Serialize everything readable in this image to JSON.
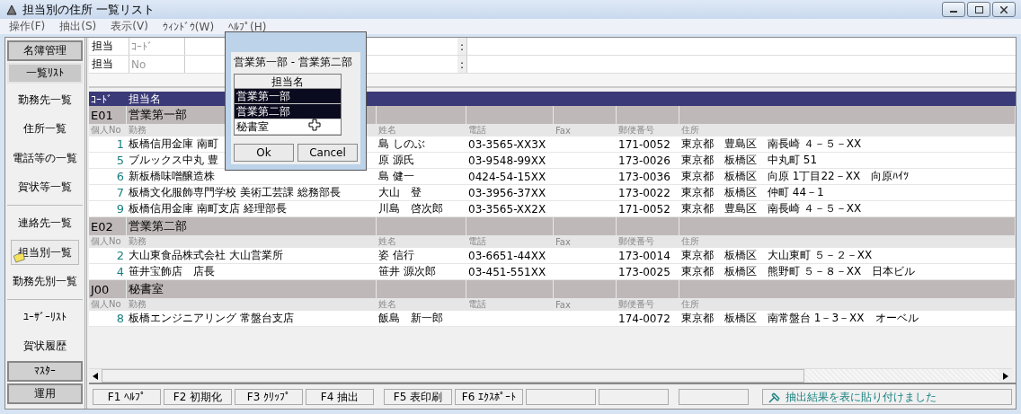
{
  "window": {
    "title": "担当別の住所 一覧リスト"
  },
  "menu": [
    {
      "label": "操作(F)"
    },
    {
      "label": "抽出(S)"
    },
    {
      "label": "表示(V)"
    },
    {
      "label": "ｳｨﾝﾄﾞｳ(W)"
    },
    {
      "label": "ﾍﾙﾌﾟ(H)"
    }
  ],
  "sidebar": {
    "items": [
      {
        "kind": "tab",
        "label": "名簿管理",
        "selected": false
      },
      {
        "kind": "tab",
        "label": "一覧ﾘｽﾄ",
        "selected": true
      },
      {
        "kind": "link",
        "label": "勤務先一覧",
        "selected": false
      },
      {
        "kind": "link",
        "label": "住所一覧",
        "selected": false
      },
      {
        "kind": "link",
        "label": "電話等の一覧",
        "selected": false
      },
      {
        "kind": "link",
        "label": "賀状等一覧",
        "selected": false
      },
      {
        "kind": "divider"
      },
      {
        "kind": "link",
        "label": "連絡先一覧",
        "selected": false
      },
      {
        "kind": "link",
        "label": "担当別一覧",
        "selected": true
      },
      {
        "kind": "link",
        "label": "勤務先別一覧",
        "selected": false
      },
      {
        "kind": "divider"
      },
      {
        "kind": "link",
        "label": "ﾕｰｻﾞｰﾘｽﾄ",
        "selected": false
      },
      {
        "kind": "link",
        "label": "賀状履歴",
        "selected": false
      }
    ],
    "bottom": [
      {
        "label": "ﾏｽﾀｰ"
      },
      {
        "label": "運用"
      }
    ]
  },
  "filter": {
    "rows": [
      {
        "label": "担当",
        "field_label": "ｺｰﾄﾞ",
        "separator": ":"
      },
      {
        "label": "担当",
        "field_label": "No",
        "separator": ":"
      }
    ]
  },
  "table": {
    "columns": [
      "ｺｰﾄﾞ",
      "担当名"
    ],
    "groups": [
      {
        "code": "E01",
        "name": "営業第一部",
        "columns": [
          "個人No",
          "勤務",
          "姓名",
          "電話",
          "Fax",
          "郵便番号",
          "住所"
        ],
        "rows": [
          {
            "no": "1",
            "work": "板橋信用金庫 南町",
            "name": "島 しのぶ",
            "phone": "03-3565-XX3X",
            "zip": "171-0052",
            "address": "東京都　豊島区　南長崎 ４－５－XX"
          },
          {
            "no": "5",
            "work": "ブルックス中丸 豊",
            "name": "原 源氏",
            "phone": "03-9548-99XX",
            "zip": "173-0026",
            "address": "東京都　板橋区　中丸町 51"
          },
          {
            "no": "6",
            "work": "新板橋味噌醸造株",
            "name": "島 健一",
            "phone": "0424-54-15XX",
            "zip": "173-0036",
            "address": "東京都　板橋区　向原 1丁目22－XX　向原ﾊｲﾂ"
          },
          {
            "no": "7",
            "work": "板橋文化服飾専門学校 美術工芸課 総務部長",
            "name": "大山　登",
            "phone": "03-3956-37XX",
            "zip": "173-0022",
            "address": "東京都　板橋区　仲町 44－1"
          },
          {
            "no": "9",
            "work": "板橋信用金庫 南町支店 経理部長",
            "name": "川島　啓次郎",
            "phone": "03-3565-XX2X",
            "zip": "171-0052",
            "address": "東京都　豊島区　南長崎 ４－５－XX"
          }
        ]
      },
      {
        "code": "E02",
        "name": "営業第二部",
        "columns": [
          "個人No",
          "勤務",
          "姓名",
          "電話",
          "Fax",
          "郵便番号",
          "住所"
        ],
        "rows": [
          {
            "no": "2",
            "work": "大山東食品株式会社 大山営業所",
            "name": "姿 信行",
            "phone": "03-6651-44XX",
            "zip": "173-0014",
            "address": "東京都　板橋区　大山東町 ５－２－XX"
          },
          {
            "no": "4",
            "work": "笹井宝飾店　店長",
            "name": "笹井 源次郎",
            "phone": "03-451-551XX",
            "zip": "173-0025",
            "address": "東京都　板橋区　熊野町 ５－８－XX　日本ビル"
          }
        ]
      },
      {
        "code": "J00",
        "name": "秘書室",
        "columns": [
          "個人No",
          "勤務",
          "姓名",
          "電話",
          "Fax",
          "郵便番号",
          "住所"
        ],
        "rows": [
          {
            "no": "8",
            "work": "板橋エンジニアリング 常盤台支店",
            "name": "飯島　新一郎",
            "zip": "174-0072",
            "address": "東京都　板橋区　南常盤台 1－3－XX　オーベル"
          }
        ]
      }
    ]
  },
  "function_keys": [
    {
      "label": "F1 ﾍﾙﾌﾟ"
    },
    {
      "label": "F2 初期化"
    },
    {
      "label": "F3 ｸﾘｯﾌﾟ"
    },
    {
      "label": "F4 抽出"
    },
    {
      "label": "F5 表印刷"
    },
    {
      "label": "F6 ｴｸｽﾎﾟｰﾄ"
    }
  ],
  "status": "抽出結果を表に貼り付けました",
  "dialog": {
    "caption": "営業第一部 - 営業第二部",
    "list_header": "担当名",
    "items": [
      {
        "label": "営業第一部",
        "selected": true
      },
      {
        "label": "営業第二部",
        "selected": true
      },
      {
        "label": "秘書室",
        "selected": false
      }
    ],
    "buttons": [
      {
        "label": "Ok"
      },
      {
        "label": "Cancel"
      }
    ]
  }
}
